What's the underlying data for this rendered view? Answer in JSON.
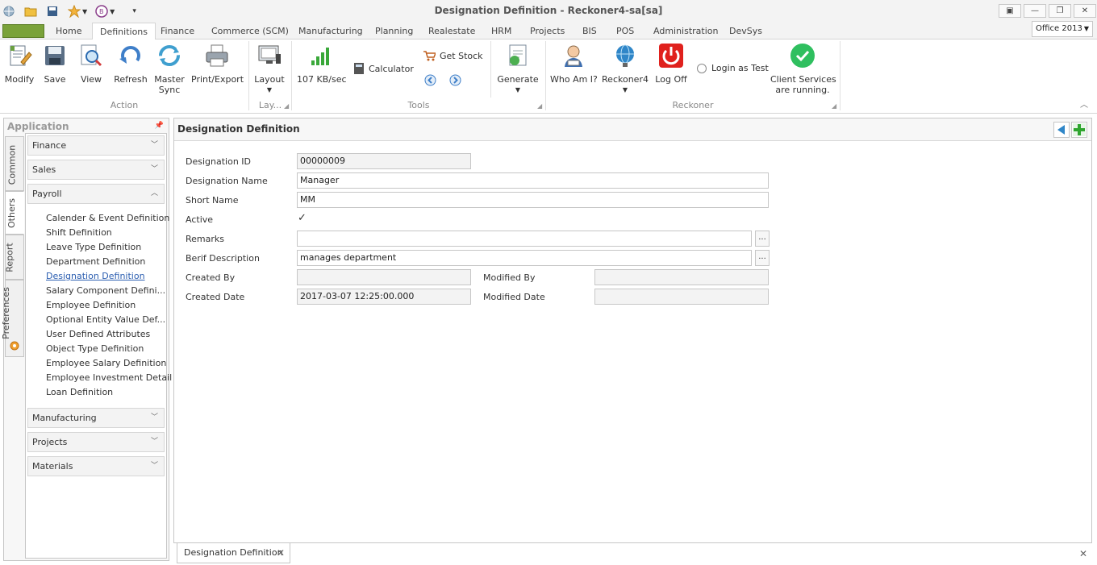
{
  "window": {
    "title_doc": "Designation Definition",
    "title_sep": " - ",
    "title_app": "Reckoner4-sa[sa]"
  },
  "ribbon_tabs": [
    "Home",
    "Definitions",
    "Finance",
    "Commerce (SCM)",
    "Manufacturing",
    "Planning",
    "Realestate",
    "HRM",
    "Projects",
    "BIS",
    "POS",
    "Administration",
    "DevSys"
  ],
  "active_tab": "Definitions",
  "style_selector": "Office 2013",
  "ribbon": {
    "action": {
      "label": "Action",
      "buttons": [
        "Modify",
        "Save",
        "View",
        "Refresh",
        "Master Sync",
        "Print/Export"
      ]
    },
    "layout": {
      "label": "Lay...",
      "button": "Layout"
    },
    "tools": {
      "label": "Tools",
      "speed": "107 KB/sec",
      "calculator": "Calculator",
      "get_stock": "Get Stock",
      "generate": "Generate"
    },
    "reckoner": {
      "label": "Reckoner",
      "who_am_i": "Who Am I?",
      "reckoner4": "Reckoner4",
      "log_off": "Log Off",
      "login_as_test": "Login as Test",
      "client_services_line1": "Client Services",
      "client_services_line2": "are running."
    },
    "colors": {
      "green_check": "#2fbf5f",
      "power_red": "#e0211d",
      "accent_blue": "#2a5db0"
    }
  },
  "left_panel": {
    "title": "Application",
    "vertical_tabs": [
      "Common",
      "Others",
      "Report",
      "Preferences"
    ],
    "groups": {
      "finance": "Finance",
      "sales": "Sales",
      "payroll": "Payroll",
      "manufacturing": "Manufacturing",
      "projects": "Projects",
      "materials": "Materials"
    },
    "payroll_items": [
      "Calender & Event Definition",
      "Shift Definition",
      "Leave Type Definition",
      "Department Definition",
      "Designation Definition",
      "Salary Component Defini...",
      "Employee Definition",
      "Optional Entity Value Def...",
      "User Defined Attributes",
      "Object Type Definition",
      "Employee Salary Definition",
      "Employee Investment Detail",
      "Loan Definition"
    ],
    "selected_item": "Designation Definition"
  },
  "form": {
    "title": "Designation Definition",
    "labels": {
      "designation_id": "Designation ID",
      "designation_name": "Designation Name",
      "short_name": "Short Name",
      "active": "Active",
      "remarks": "Remarks",
      "brief_description": "Berif Description",
      "created_by": "Created By",
      "created_date": "Created Date",
      "modified_by": "Modified By",
      "modified_date": "Modified Date"
    },
    "values": {
      "designation_id": "00000009",
      "designation_name": "Manager",
      "short_name": "MM",
      "active": true,
      "remarks": "",
      "brief_description": "manages department",
      "created_by": "",
      "created_date": "2017-03-07 12:25:00.000",
      "modified_by": "",
      "modified_date": ""
    },
    "ellipsis_label": "..."
  },
  "document_tab": "Designation Definition"
}
